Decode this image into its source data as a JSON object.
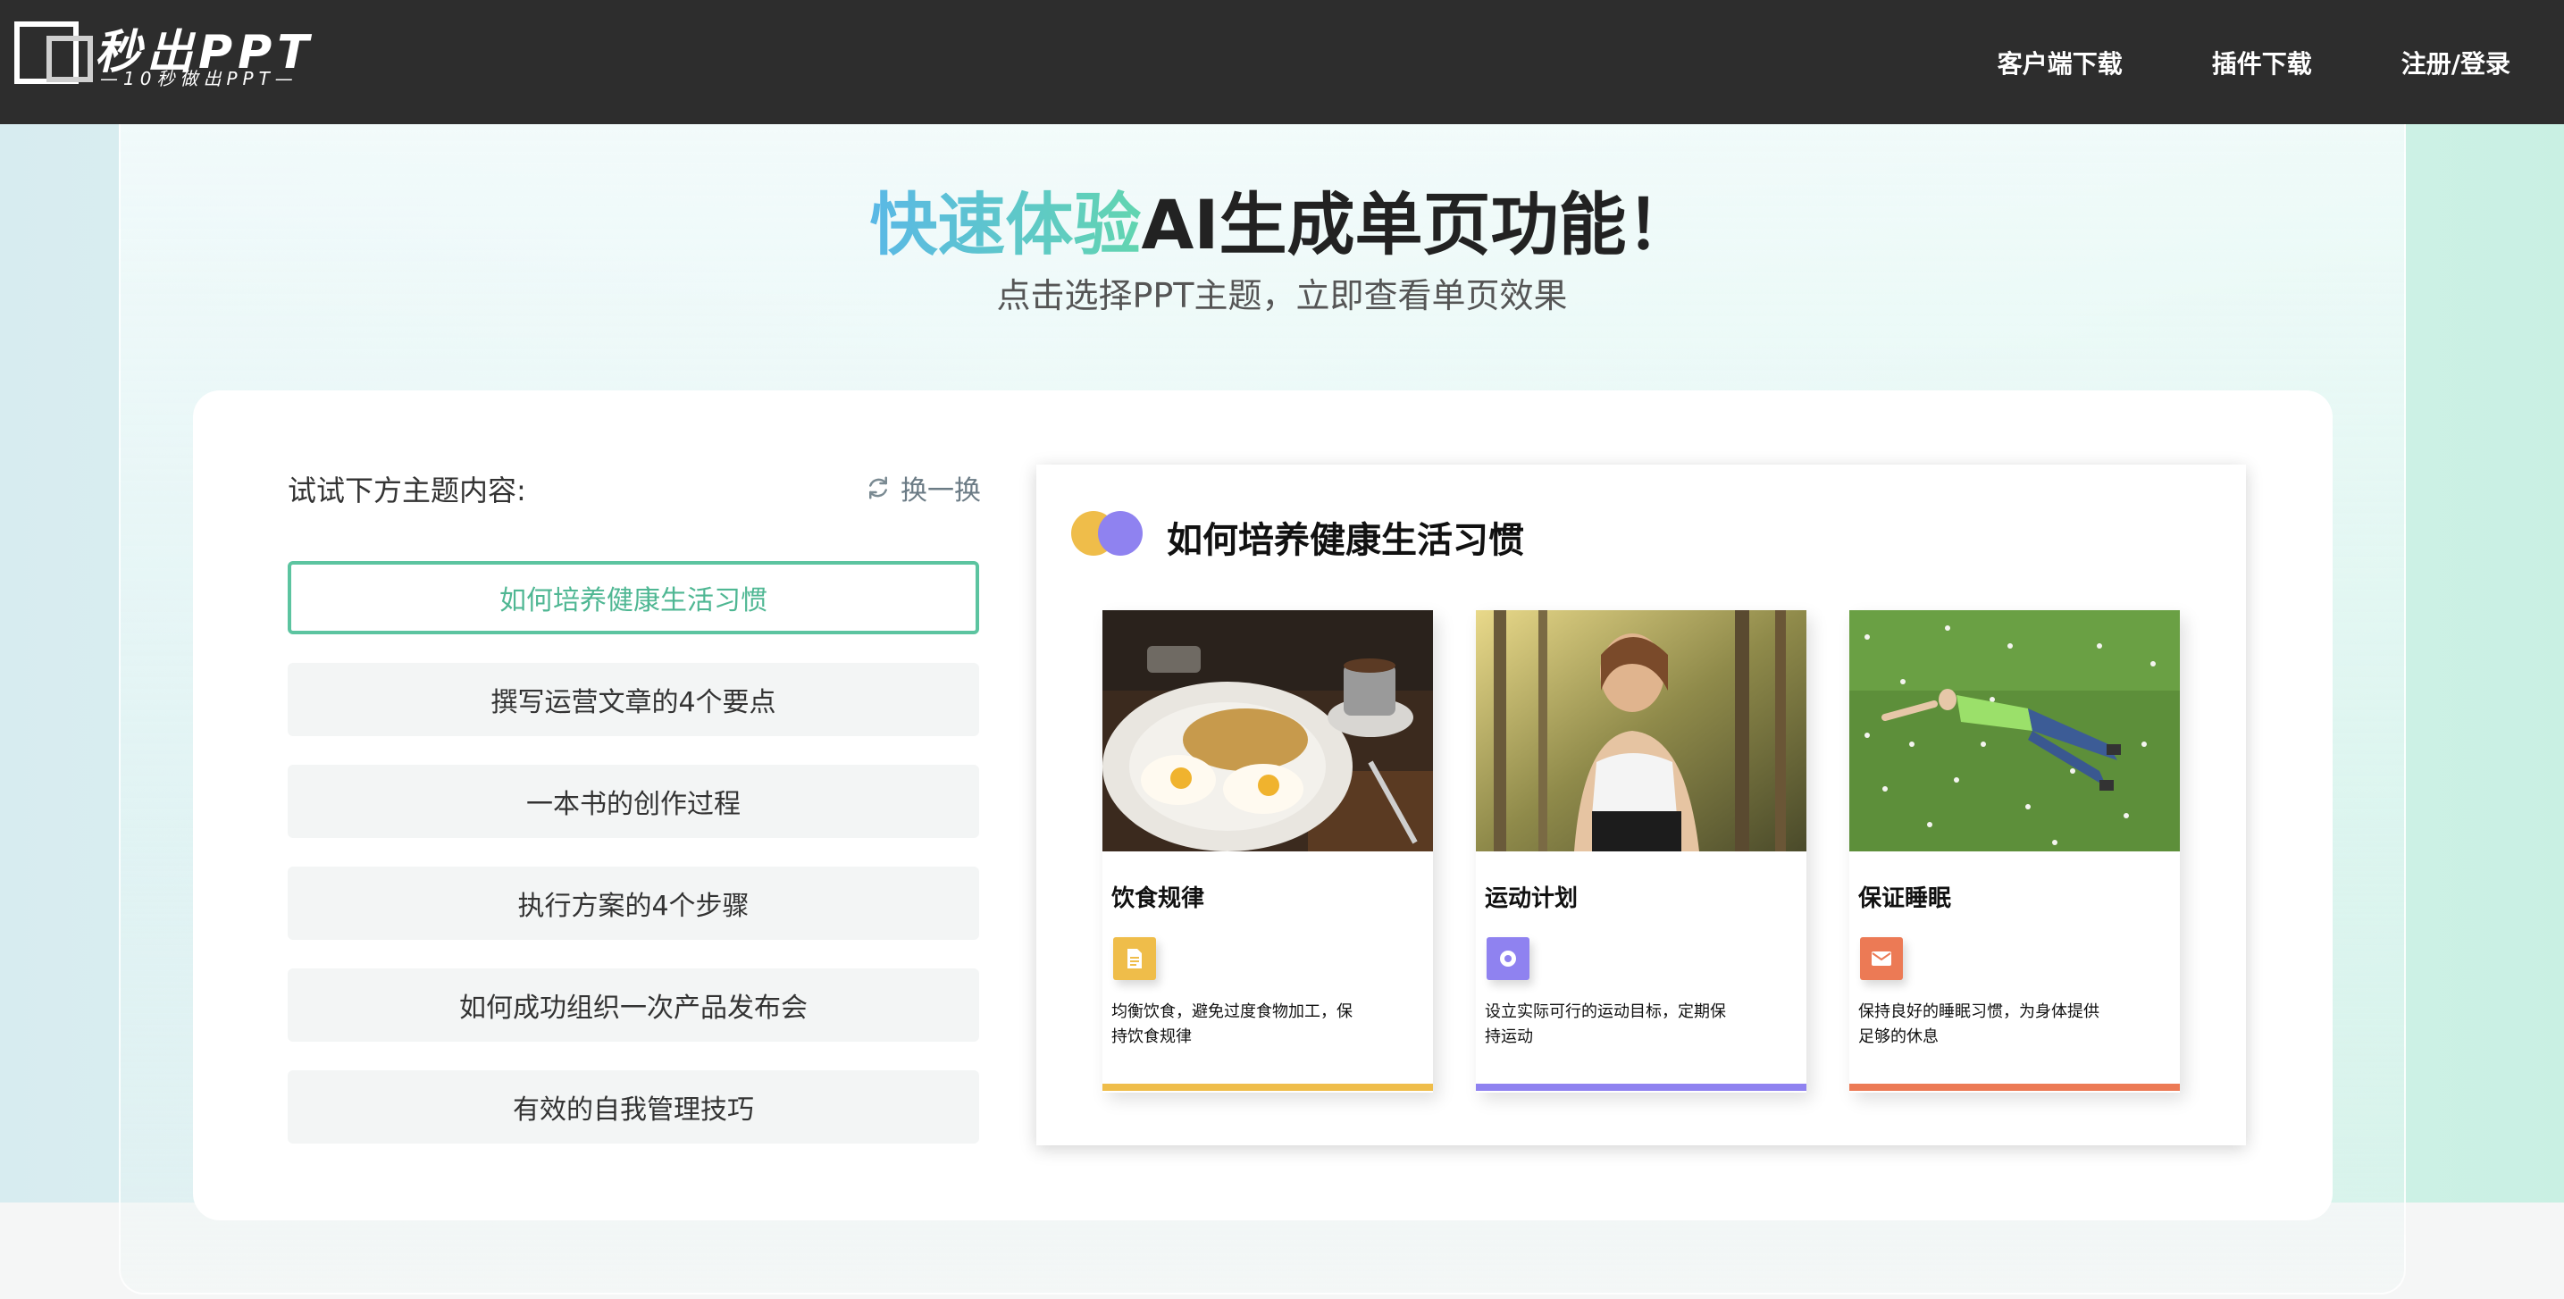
{
  "header": {
    "logo_title": "秒出PPT",
    "logo_subtitle": "—10秒做出PPT—",
    "nav": [
      "客户端下载",
      "插件下载",
      "注册/登录"
    ]
  },
  "hero": {
    "headline_accent": "快速体验",
    "headline_rest": "AI生成单页功能！",
    "subtitle": "点击选择PPT主题，立即查看单页效果"
  },
  "panel": {
    "label": "试试下方主题内容:",
    "refresh_label": "换一换",
    "topics": [
      "如何培养健康生活习惯",
      "撰写运营文章的4个要点",
      "一本书的创作过程",
      "执行方案的4个步骤",
      "如何成功组织一次产品发布会",
      "有效的自我管理技巧"
    ],
    "active_index": 0
  },
  "preview": {
    "title": "如何培养健康生活习惯",
    "columns": [
      {
        "heading": "饮食规律",
        "description": "均衡饮食，避免过度食物加工，保持饮食规律",
        "icon": "document-icon",
        "color": "#efbd4a"
      },
      {
        "heading": "运动计划",
        "description": "设立实际可行的运动目标，定期保持运动",
        "icon": "target-icon",
        "color": "#8f82f0"
      },
      {
        "heading": "保证睡眠",
        "description": "保持良好的睡眠习惯，为身体提供足够的休息",
        "icon": "mail-icon",
        "color": "#ec7a55"
      }
    ]
  },
  "colors": {
    "accent_green": "#5cc4a0",
    "header_bg": "#2d2d2d"
  }
}
